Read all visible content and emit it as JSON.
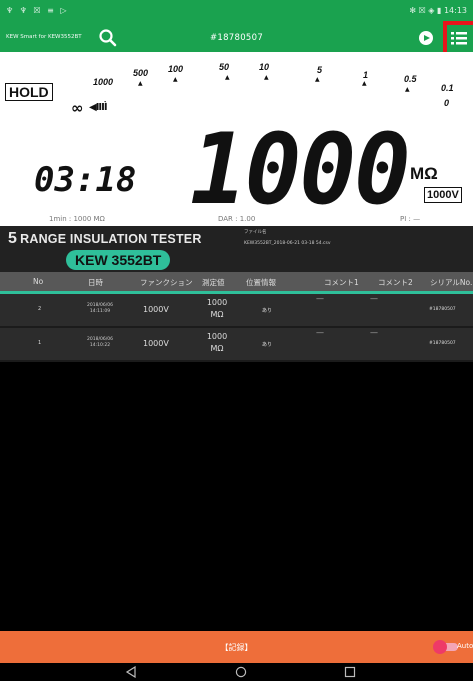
{
  "status_bar": {
    "left_icons": "♆ ♆ ☒ ≡ ▷",
    "right_text": "✻ ☒ ◈ ▮ 14:13"
  },
  "app_bar": {
    "app_title": "KEW Smart for KEW3552BT",
    "serial": "#18780507",
    "icons": [
      "search-icon",
      "play-icon",
      "menu-list-icon"
    ],
    "accent_color": "#1aa24f",
    "highlight_color": "#e8141b"
  },
  "meter": {
    "hold_label": "HOLD",
    "scale": {
      "labels": [
        "1000",
        "500",
        "100",
        "50",
        "10",
        "5",
        "1",
        "0.5",
        "0.1",
        "0"
      ],
      "infinity": "∞",
      "bars": "◀IIIÌ"
    },
    "reading": "1000",
    "unit": "MΩ",
    "timer": "03:18",
    "test_voltage": "1000V",
    "one_min": "1min : 1000 MΩ",
    "dar": "DAR : 1.00",
    "pi": "PI : —"
  },
  "brand": {
    "line_prefix": "5",
    "line_rest": "RANGE INSULATION TESTER",
    "model": "KEW 3552BT",
    "file_label": "ファイル名",
    "file_name": "KEW3552BT_2018-06-21 03-18 54.csv"
  },
  "table": {
    "headers": [
      "No",
      "日時",
      "ファンクション",
      "測定値",
      "位置情報",
      "コメント1",
      "コメント2",
      "シリアルNo."
    ],
    "rows": [
      {
        "no": "2",
        "date": "2018/06/06",
        "time": "14:11:09",
        "function": "1000V",
        "value": "1000",
        "unit": "MΩ",
        "location": "あり",
        "comment1": "—",
        "comment2": "—",
        "serial": "#18780507"
      },
      {
        "no": "1",
        "date": "2018/06/06",
        "time": "14:10:22",
        "function": "1000V",
        "value": "1000",
        "unit": "MΩ",
        "location": "あり",
        "comment1": "—",
        "comment2": "—",
        "serial": "#18780507"
      }
    ]
  },
  "bottom_bar": {
    "record_label": "【記録】",
    "auto_label": "Auto",
    "color": "#ee6e3a"
  },
  "nav_bar": {
    "icons": [
      "back-icon",
      "home-icon",
      "recents-icon"
    ]
  }
}
